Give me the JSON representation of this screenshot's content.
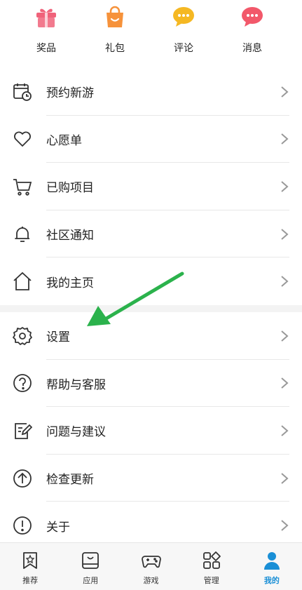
{
  "quick_actions": [
    {
      "label": "奖品",
      "icon": "gift-icon",
      "color": "#f0627a"
    },
    {
      "label": "礼包",
      "icon": "bag-icon",
      "color": "#f6923b"
    },
    {
      "label": "评论",
      "icon": "comment-icon",
      "color": "#f5b823"
    },
    {
      "label": "消息",
      "icon": "message-icon",
      "color": "#f2586a"
    }
  ],
  "menu_group_1": [
    {
      "label": "预约新游",
      "icon": "calendar-clock-icon"
    },
    {
      "label": "心愿单",
      "icon": "heart-icon"
    },
    {
      "label": "已购项目",
      "icon": "cart-icon"
    },
    {
      "label": "社区通知",
      "icon": "bell-icon"
    },
    {
      "label": "我的主页",
      "icon": "home-icon"
    }
  ],
  "menu_group_2": [
    {
      "label": "设置",
      "icon": "gear-icon"
    },
    {
      "label": "帮助与客服",
      "icon": "help-icon"
    },
    {
      "label": "问题与建议",
      "icon": "edit-note-icon"
    },
    {
      "label": "检查更新",
      "icon": "upload-arrow-icon"
    },
    {
      "label": "关于",
      "icon": "info-exclamation-icon"
    }
  ],
  "tabbar": [
    {
      "label": "推荐",
      "icon": "bookmark-star-icon",
      "active": false
    },
    {
      "label": "应用",
      "icon": "app-store-icon",
      "active": false
    },
    {
      "label": "游戏",
      "icon": "gamepad-icon",
      "active": false
    },
    {
      "label": "管理",
      "icon": "grid-icon",
      "active": false
    },
    {
      "label": "我的",
      "icon": "person-icon",
      "active": true
    }
  ],
  "colors": {
    "accent": "#1a8fd6",
    "annotation_arrow": "#2bb24c"
  }
}
